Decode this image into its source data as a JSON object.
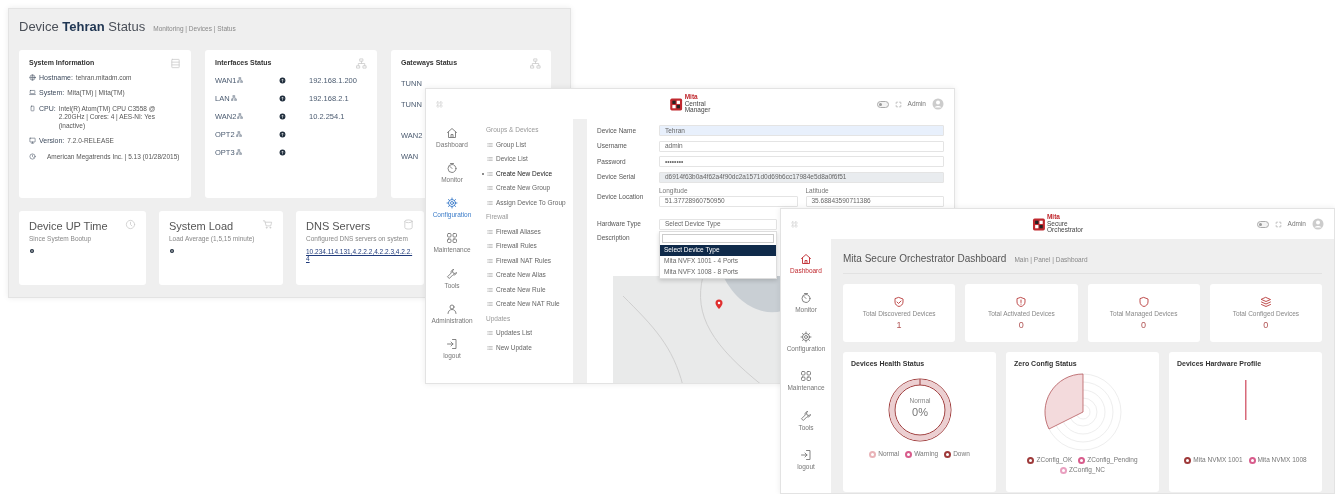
{
  "status_window": {
    "title": "Device **Tehran** Status",
    "breadcrumb": "Monitoring | Devices | Status",
    "system_info": {
      "title": "System Information",
      "rows": [
        {
          "kind": "hostname",
          "label": "Hostname:",
          "value": "tehran.mitadm.com"
        },
        {
          "kind": "system",
          "label": "System:",
          "value": "Mita(TM) | Mita(TM)"
        },
        {
          "kind": "cpu",
          "label": "CPU:",
          "value": "Intel(R) Atom(TM) CPU C3558 @ 2.20GHz | Cores: 4 | AES-NI: Yes (inactive)"
        },
        {
          "kind": "version",
          "label": "Version:",
          "value": "7.2.0-RELEASE"
        },
        {
          "kind": "bios",
          "value": "American Megatrends Inc. | 5.13 (01/28/2015)"
        }
      ]
    },
    "interfaces": {
      "title": "Interfaces Status",
      "rows": [
        {
          "name": "WAN1",
          "ip": "192.168.1.200"
        },
        {
          "name": "LAN",
          "ip": "192.168.2.1"
        },
        {
          "name": "WAN2",
          "ip": "10.2.254.1"
        },
        {
          "name": "OPT2"
        },
        {
          "name": "OPT3"
        }
      ]
    },
    "gateways": {
      "title": "Gateways Status",
      "rows": [
        "TUNN",
        "TUNN",
        "WAN2",
        "WAN"
      ]
    },
    "stats": [
      {
        "kind": "uptime",
        "title": "Device UP Time",
        "subtitle": "Since System Bootup"
      },
      {
        "kind": "load",
        "title": "System Load",
        "subtitle": "Load Average (1,5,15 minute)"
      },
      {
        "kind": "dns",
        "title": "DNS Servers",
        "subtitle": "Configured DNS servers on system",
        "value": "10.234.114.131,4.2.2.2,4.2.2.3,4.2.2.4"
      }
    ]
  },
  "device_window": {
    "brand": [
      "Mita",
      "Central",
      "Manager"
    ],
    "dark_mode": false,
    "user": "Admin",
    "nav": [
      {
        "kind": "dashboard",
        "label": "Dashboard",
        "selected": false
      },
      {
        "kind": "monitor",
        "label": "Monitor",
        "selected": false
      },
      {
        "kind": "configuration",
        "label": "Configuration",
        "selected": true
      },
      {
        "kind": "maintenance",
        "label": "Maintenance",
        "selected": false
      },
      {
        "kind": "tools",
        "label": "Tools",
        "selected": false
      },
      {
        "kind": "administration",
        "label": "Administration",
        "selected": false
      },
      {
        "kind": "logout",
        "label": "logout",
        "selected": false
      }
    ],
    "menu": [
      {
        "kind": "header",
        "label": "Groups & Devices"
      },
      {
        "kind": "item",
        "label": "Group List",
        "selected": false
      },
      {
        "kind": "item",
        "label": "Device List",
        "selected": false
      },
      {
        "kind": "item",
        "label": "Create New Device",
        "selected": true
      },
      {
        "kind": "item",
        "label": "Create New Group",
        "selected": false
      },
      {
        "kind": "item",
        "label": "Assign Device To Group",
        "selected": false
      },
      {
        "kind": "header",
        "label": "Firewall"
      },
      {
        "kind": "item",
        "label": "Firewall Aliases",
        "selected": false
      },
      {
        "kind": "item",
        "label": "Firewall Rules",
        "selected": false
      },
      {
        "kind": "item",
        "label": "Firewall NAT Rules",
        "selected": false
      },
      {
        "kind": "item",
        "label": "Create New Alias",
        "selected": false
      },
      {
        "kind": "item",
        "label": "Create New Rule",
        "selected": false
      },
      {
        "kind": "item",
        "label": "Create New NAT Rule",
        "selected": false
      },
      {
        "kind": "header",
        "label": "Updates"
      },
      {
        "kind": "item",
        "label": "Updates List",
        "selected": false
      },
      {
        "kind": "item",
        "label": "New Update",
        "selected": false
      }
    ],
    "form": [
      {
        "kind": "autofill",
        "label": "Device Name",
        "value": "Tehran"
      },
      {
        "kind": "text",
        "label": "Username",
        "value": "admin"
      },
      {
        "kind": "password",
        "label": "Password",
        "value": "••••••••"
      },
      {
        "kind": "readonly",
        "label": "Device Serial",
        "value": "d6914f63b0a4f62a4f90dc2a1571d0d69b6cc17984e5d8a0f6f51"
      },
      {
        "kind": "location",
        "label": "Device Location",
        "fields": [
          {
            "label": "Longitude",
            "value": "51.37728960750950"
          },
          {
            "label": "Latitude",
            "value": "35.68843590711386"
          }
        ]
      },
      {
        "kind": "select",
        "label": "Hardware Type",
        "value": "Select Device Type",
        "options": [
          {
            "label": "Select Device Type",
            "selected": true
          },
          {
            "label": "Mita NVFX 1001 - 4 Ports",
            "selected": false
          },
          {
            "label": "Mita NVFX 1008 - 8 Ports",
            "selected": false
          }
        ]
      },
      {
        "kind": "textarea",
        "label": "Description"
      }
    ]
  },
  "dashboard_window": {
    "brand": [
      "Mita",
      "Secure",
      "Orchestrator"
    ],
    "dark_mode": false,
    "user": "Admin",
    "nav": [
      {
        "kind": "dashboard",
        "label": "Dashboard",
        "selected": true
      },
      {
        "kind": "monitor",
        "label": "Monitor",
        "selected": false
      },
      {
        "kind": "configuration",
        "label": "Configuration",
        "selected": false
      },
      {
        "kind": "maintenance",
        "label": "Maintenance",
        "selected": false
      },
      {
        "kind": "tools",
        "label": "Tools",
        "selected": false
      },
      {
        "kind": "logout",
        "label": "logout",
        "selected": false
      }
    ],
    "title": "Mita Secure Orchestrator Dashboard",
    "breadcrumb": "Main | Panel | Dashboard",
    "stats": [
      {
        "kind": "discovered",
        "label": "Total Discovered Devices",
        "value": "1"
      },
      {
        "kind": "activated",
        "label": "Total Activated Devices",
        "value": "0"
      },
      {
        "kind": "managed",
        "label": "Total Managed Devices",
        "value": "0"
      },
      {
        "kind": "configured",
        "label": "Total Configed Devices",
        "value": "0"
      }
    ],
    "charts": [
      {
        "kind": "donut",
        "title": "Devices Health Status",
        "center_label": "Normal",
        "center_value": "0%",
        "legend": [
          {
            "label": "Normal",
            "color": "#e9b3b8"
          },
          {
            "label": "Warning",
            "color": "#d85c8c"
          },
          {
            "label": "Down",
            "color": "#9e3a3a"
          }
        ]
      },
      {
        "kind": "polar",
        "title": "Zero Config Status",
        "legend": [
          {
            "label": "ZConfig_OK",
            "color": "#9e3a3a"
          },
          {
            "label": "ZConfig_Pending",
            "color": "#d85c8c"
          },
          {
            "label": "ZConfig_NC",
            "color": "#e9a0c0"
          }
        ]
      },
      {
        "kind": "bar",
        "title": "Devices Hardware Profile",
        "legend": [
          {
            "label": "Mita NVMX 1001",
            "color": "#9e3a3a"
          },
          {
            "label": "Mita NVMX 1008",
            "color": "#d85c8c"
          }
        ]
      }
    ]
  }
}
